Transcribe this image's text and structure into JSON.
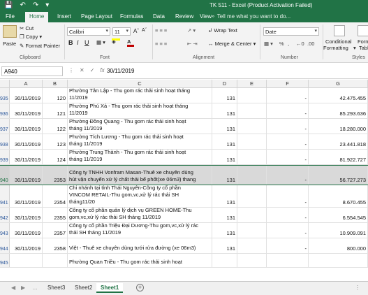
{
  "window": {
    "title": "TK 511 - Excel (Product Activation Failed)"
  },
  "ribbon_tabs": [
    "File",
    "Home",
    "Insert",
    "Page Layout",
    "Formulas",
    "Data",
    "Review",
    "View"
  ],
  "tell_me": "Tell me what you want to do...",
  "ribbon": {
    "paste": "Paste",
    "cut": "Cut",
    "copy": "Copy",
    "format_painter": "Format Painter",
    "clipboard": "Clipboard",
    "font_name": "Calibri",
    "font_size": "11",
    "bold": "B",
    "italic": "I",
    "underline": "U",
    "font": "Font",
    "wrap_text": "Wrap Text",
    "merge_center": "Merge & Center",
    "alignment": "Alignment",
    "number_format": "Date",
    "number": "Number",
    "conditional_formatting_1": "Conditional",
    "conditional_formatting_2": "Formatting",
    "format_table_1": "Format",
    "format_table_2": "Table",
    "styles": "Styles"
  },
  "formula_bar": {
    "name_box": "A940",
    "fx": "fx",
    "value": "30/11/2019"
  },
  "columns": [
    "A",
    "B",
    "C",
    "D",
    "E",
    "F",
    "G"
  ],
  "rows": [
    {
      "num": "935",
      "a": "30/11/2019",
      "b": "120",
      "c": [
        "Phường Tân Lập - Thu gom rác thải sinh hoạt tháng",
        "11/2019"
      ],
      "d": "131",
      "e": "",
      "f": "-",
      "g": "42.475.455"
    },
    {
      "num": "936",
      "a": "30/11/2019",
      "b": "121",
      "c": [
        "Phường Phú Xá - Thu gom rác thải sinh hoạt tháng",
        "11/2019"
      ],
      "d": "131",
      "e": "",
      "f": "-",
      "g": "85.293.636"
    },
    {
      "num": "937",
      "a": "30/11/2019",
      "b": "122",
      "c": [
        "Phường Đồng Quang - Thu gom rác thải sinh hoạt",
        "tháng 11/2019"
      ],
      "d": "131",
      "e": "",
      "f": "-",
      "g": "18.280.000"
    },
    {
      "num": "938",
      "a": "30/11/2019",
      "b": "123",
      "c": [
        "Phường Tích Lương - Thu gom rác thải sinh hoạt",
        "tháng 11/2019"
      ],
      "d": "131",
      "e": "",
      "f": "-",
      "g": "23.441.818"
    },
    {
      "num": "939",
      "a": "30/11/2019",
      "b": "124",
      "c": [
        "Phường Trung Thành - Thu gom rác thải sinh hoạt",
        "tháng 11/2019"
      ],
      "d": "131",
      "e": "",
      "f": "-",
      "g": "81.922.727"
    },
    {
      "num": "940",
      "a": "30/11/2019",
      "b": "2353",
      "c": [
        "Công ty TNHH Vonfram Masan-Thuê xe chuyên dùng",
        "hút vận chuyển xử lý chất thải bể phốt(xe 06m3) thang"
      ],
      "d": "131",
      "e": "",
      "f": "-",
      "g": "56.727.273"
    },
    {
      "num": "941",
      "a": "30/11/2019",
      "b": "2354",
      "c": [
        "Chi nhánh tại tỉnh Thái Nguyên-Công ty cổ phần",
        "VINCOM RETAIL-Thu gom,vc,xử lý rác thải SH",
        "tháng11/20"
      ],
      "d": "131",
      "e": "",
      "f": "-",
      "g": "8.670.455"
    },
    {
      "num": "942",
      "a": "30/11/2019",
      "b": "2355",
      "c": [
        "Công ty cổ phần quản lý dịch vụ GREEN HOME-Thu",
        "gom,vc,xử lý rác thải SH tháng 11/2019"
      ],
      "d": "131",
      "e": "",
      "f": "-",
      "g": "6.554.545"
    },
    {
      "num": "943",
      "a": "30/11/2019",
      "b": "2357",
      "c": [
        "Công ty cổ phần Triệu Đại Dương-Thu gom,vc,xử lý rác",
        "thải SH tháng 11/2019"
      ],
      "d": "131",
      "e": "",
      "f": "-",
      "g": "10.909.091"
    },
    {
      "num": "944",
      "a": "30/11/2019",
      "b": "2358",
      "c": [
        "Việt - Thuê xe chuyên dùng tưới rửa đường (xe 06m3)"
      ],
      "d": "131",
      "e": "",
      "f": "-",
      "g": "800.000"
    },
    {
      "num": "945",
      "a": "",
      "b": "",
      "c": [
        "Phường Quan Triều - Thu gom rác thải sinh hoạt"
      ],
      "d": "",
      "e": "",
      "f": "",
      "g": ""
    }
  ],
  "sheets": [
    "Sheet3",
    "Sheet2",
    "Sheet1"
  ],
  "colors": {
    "excel_green": "#217346",
    "selected_row": "#d9d9d9"
  }
}
